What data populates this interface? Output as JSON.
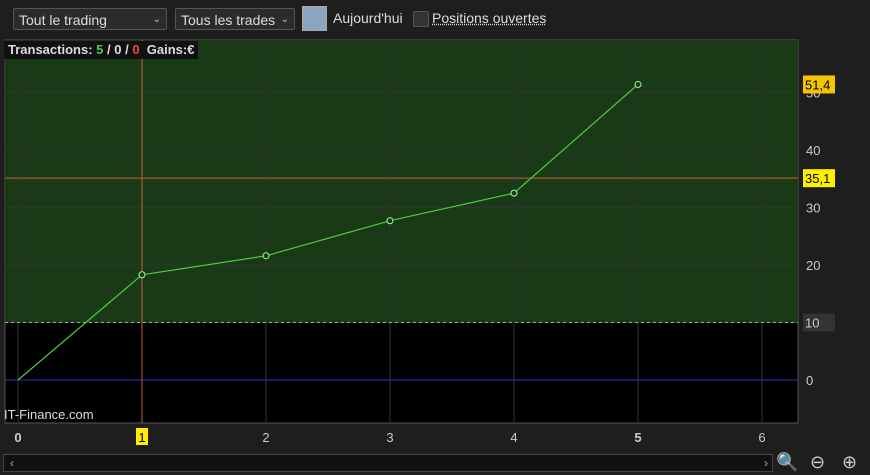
{
  "toolbar": {
    "scope": "Tout le trading",
    "trades": "Tous les trades",
    "today": "Aujourd'hui",
    "open_positions": "Positions ouvertes"
  },
  "info": {
    "label": "Transactions:",
    "wins": "5",
    "neutral": "0",
    "losses": "0",
    "gains_label": "Gains:",
    "currency": "€"
  },
  "watermark": "IT-Finance.com",
  "colors": {
    "profit_zone": "#1a3a17",
    "line": "#4ccc3c",
    "marker_line": "#c0603a",
    "zero_line": "#3030c0",
    "highlight": "#ffee00"
  },
  "chart_data": {
    "type": "line",
    "x": [
      0,
      1,
      2,
      3,
      4,
      5
    ],
    "y": [
      0,
      18.3,
      21.6,
      27.7,
      32.5,
      51.4
    ],
    "xlim": [
      -0.1,
      6.3
    ],
    "ylim": [
      -7.5,
      59
    ],
    "x_ticks": [
      "0",
      "1",
      "2",
      "3",
      "4",
      "5",
      "6"
    ],
    "y_ticks": [
      "0",
      "10",
      "20",
      "30",
      "40",
      "50"
    ],
    "highlight_x": 1,
    "highlight_y": 35.1,
    "threshold": 10,
    "labels": {
      "last": "51,4",
      "cursor": "35,1",
      "threshold": "10"
    },
    "grid": true
  }
}
